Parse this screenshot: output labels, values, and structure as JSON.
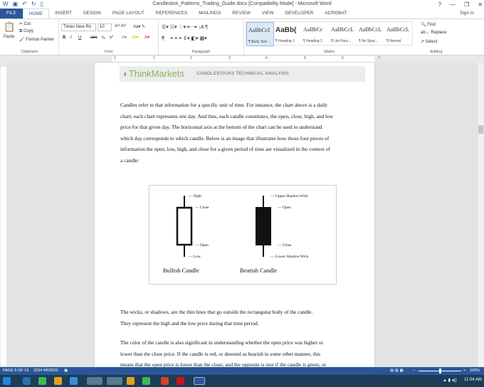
{
  "window": {
    "title": "Candlestick_Patterns_Trading_Guide.docx [Compatibility Mode] - Microsoft Word",
    "help": "?",
    "min": "—",
    "max": "❐",
    "close": "✕"
  },
  "tabs": [
    "FILE",
    "HOME",
    "INSERT",
    "DESIGN",
    "PAGE LAYOUT",
    "REFERENCES",
    "MAILINGS",
    "REVIEW",
    "VIEW",
    "DEVELOPER",
    "ACROBAT"
  ],
  "signin": "Sign in",
  "ribbon": {
    "clipboard": {
      "paste": "Paste",
      "cut": "Cut",
      "copy": "Copy",
      "format_painter": "Format Painter",
      "label": "Clipboard"
    },
    "font": {
      "name": "Times New Ro",
      "size": "10",
      "label": "Font",
      "bold": "B",
      "italic": "I",
      "underline": "U",
      "strike": "abc",
      "sub": "x₂",
      "sup": "x²"
    },
    "paragraph": {
      "label": "Paragraph"
    },
    "styles": {
      "label": "Styles",
      "items": [
        {
          "preview": "AaBbCcI",
          "name": "¶ Body Text"
        },
        {
          "preview": "AaBb(",
          "name": "¶ Heading 1"
        },
        {
          "preview": "AaBbCc",
          "name": "¶ Heading 2"
        },
        {
          "preview": "AaBbCcL",
          "name": "¶ List Para..."
        },
        {
          "preview": "AaBbCcL",
          "name": "¶ No Spac..."
        },
        {
          "preview": "AaBbCcL",
          "name": "¶ Normal"
        }
      ]
    },
    "editing": {
      "find": "Find",
      "replace": "Replace",
      "select": "Select",
      "label": "Editing"
    }
  },
  "ruler": [
    "1",
    "1",
    "2",
    "3",
    "4",
    "5",
    "6",
    "7"
  ],
  "header": {
    "logo": "ThinkMarkets",
    "title": "CANDLESTICKS TECHNICAL ANALYSIS"
  },
  "para1": [
    "Candles refer to that information for a specific unit of time. For instance, the chart above is a daily",
    "chart; each chart represents one day. And thus, each candle constitutes, the open, close, high, and low",
    "price for that given day. The horizontal axis at the bottom of the chart can be used to understand",
    "which day corresponds to which candle. Below is an image that illustrates how those four pieces of",
    "information the open, low, high, and close for a given period of time are visualized in the context of",
    "a candle:"
  ],
  "figure": {
    "bullish": {
      "caption": "Bullish Candle",
      "high": "— High",
      "close": "— Close",
      "open": "— Open",
      "low": "— Low"
    },
    "bearish": {
      "caption": "Bearish Candle",
      "upper": "— Upper Shadow/Wick",
      "open": "— Open",
      "close": "— Close",
      "lower": "— Lower Shadow/Wick"
    }
  },
  "para2": [
    "The wicks, or shadows, are the thin lines that go outside the rectangular body of the candle.",
    "They represent the high and the low price during that time period."
  ],
  "para3": [
    "The color of the candle is also significant in understanding whether the open price was higher or",
    "lower than the close price. If the candle is red, or denoted as bearish in some other manner, this",
    "means that the open price is lower than the close; and the opposite is true if the candle is green, or"
  ],
  "status": {
    "page": "PAGE 5 OF 19",
    "words": "3334 WORDS",
    "zoom": "100%"
  },
  "taskbar": {
    "time": "11:04 AM"
  }
}
